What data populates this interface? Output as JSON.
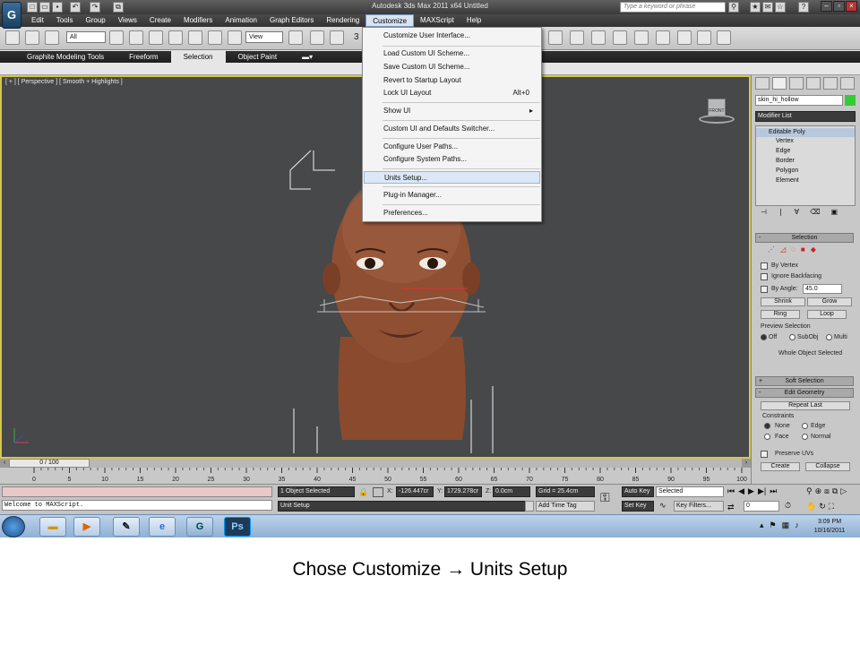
{
  "window": {
    "title": "Autodesk 3ds Max  2011 x64     Untitled",
    "search_placeholder": "Type a keyword or phrase"
  },
  "menubar": [
    "Edit",
    "Tools",
    "Group",
    "Views",
    "Create",
    "Modifiers",
    "Animation",
    "Graph Editors",
    "Rendering",
    "Customize",
    "MAXScript",
    "Help"
  ],
  "active_menu": "Customize",
  "toolbar": {
    "selection_filter": "All",
    "ref_coord": "View",
    "snap_num": "3"
  },
  "ribbon": {
    "tabs": [
      "Graphite Modeling Tools",
      "Freeform",
      "Selection",
      "Object Paint"
    ],
    "active_tab": "Selection"
  },
  "customize_menu": {
    "items": [
      {
        "label": "Customize User Interface...",
        "shortcut": "",
        "arrow": false
      },
      {
        "label": "Load Custom UI Scheme...",
        "shortcut": "",
        "arrow": false
      },
      {
        "label": "Save Custom UI Scheme...",
        "shortcut": "",
        "arrow": false
      },
      {
        "label": "Revert to Startup Layout",
        "shortcut": "",
        "arrow": false
      },
      {
        "label": "Lock UI Layout",
        "shortcut": "Alt+0",
        "arrow": false
      },
      {
        "label": "Show UI",
        "shortcut": "",
        "arrow": true
      },
      {
        "label": "Custom UI and Defaults Switcher...",
        "shortcut": "",
        "arrow": false
      },
      {
        "label": "Configure User Paths...",
        "shortcut": "",
        "arrow": false
      },
      {
        "label": "Configure System Paths...",
        "shortcut": "",
        "arrow": false
      },
      {
        "label": "Units Setup...",
        "shortcut": "",
        "arrow": false
      },
      {
        "label": "Plug-in Manager...",
        "shortcut": "",
        "arrow": false
      },
      {
        "label": "Preferences...",
        "shortcut": "",
        "arrow": false
      }
    ],
    "highlighted": "Units Setup..."
  },
  "viewport": {
    "label": "[ + ] [ Perspective ] [ Smooth + Highlights ]",
    "viewcube_label": "FRONT"
  },
  "command_panel": {
    "object_name": "skin_hi_hollow",
    "modifier_list": "Modifier List",
    "stack": [
      "Editable Poly",
      "Vertex",
      "Edge",
      "Border",
      "Polygon",
      "Element"
    ],
    "selection": {
      "title": "Selection",
      "by_vertex": "By Vertex",
      "ignore_backfacing": "Ignore Backfacing",
      "by_angle": "By Angle:",
      "angle_value": "45.0",
      "shrink": "Shrink",
      "grow": "Grow",
      "ring": "Ring",
      "loop": "Loop",
      "preview_title": "Preview Selection",
      "preview_options": [
        "Off",
        "SubObj",
        "Multi"
      ],
      "status": "Whole Object Selected"
    },
    "soft_selection": "Soft Selection",
    "edit_geometry": {
      "title": "Edit Geometry",
      "repeat_last": "Repeat Last",
      "constraints": "Constraints",
      "options": [
        "None",
        "Edge",
        "Face",
        "Normal"
      ],
      "preserve_uvs": "Preserve UVs",
      "create": "Create",
      "collapse": "Collapse"
    }
  },
  "timeline": {
    "frame": "0 / 100",
    "ticks": [
      "0",
      "5",
      "10",
      "15",
      "20",
      "25",
      "30",
      "35",
      "40",
      "45",
      "50",
      "55",
      "60",
      "65",
      "70",
      "75",
      "80",
      "85",
      "90",
      "95",
      "100"
    ]
  },
  "status": {
    "maxscript_line": "Welcome to MAXScript.",
    "objects_selected": "1 Object Selected",
    "prompt": "Unit Setup",
    "x_label": "X:",
    "x_value": "-126.447cr",
    "y_label": "Y:",
    "y_value": "1729.278cr",
    "z_label": "Z:",
    "z_value": "0.0cm",
    "grid": "Grid = 25.4cm",
    "add_time_tag": "Add Time Tag",
    "auto_key": "Auto Key",
    "set_key": "Set Key",
    "selected": "Selected",
    "key_filters": "Key Filters...",
    "frame_field": "0"
  },
  "taskbar": {
    "time": "3:09 PM",
    "date": "10/16/2011"
  },
  "caption": {
    "pre": "Chose  Customize ",
    "arrow": "→",
    "post": " Units Setup"
  },
  "colors": {
    "viewport_bg": "#46484a",
    "viewport_border": "#d6c74a",
    "menu_highlight": "#dce8f6",
    "taskbar": "#a7c1de"
  }
}
